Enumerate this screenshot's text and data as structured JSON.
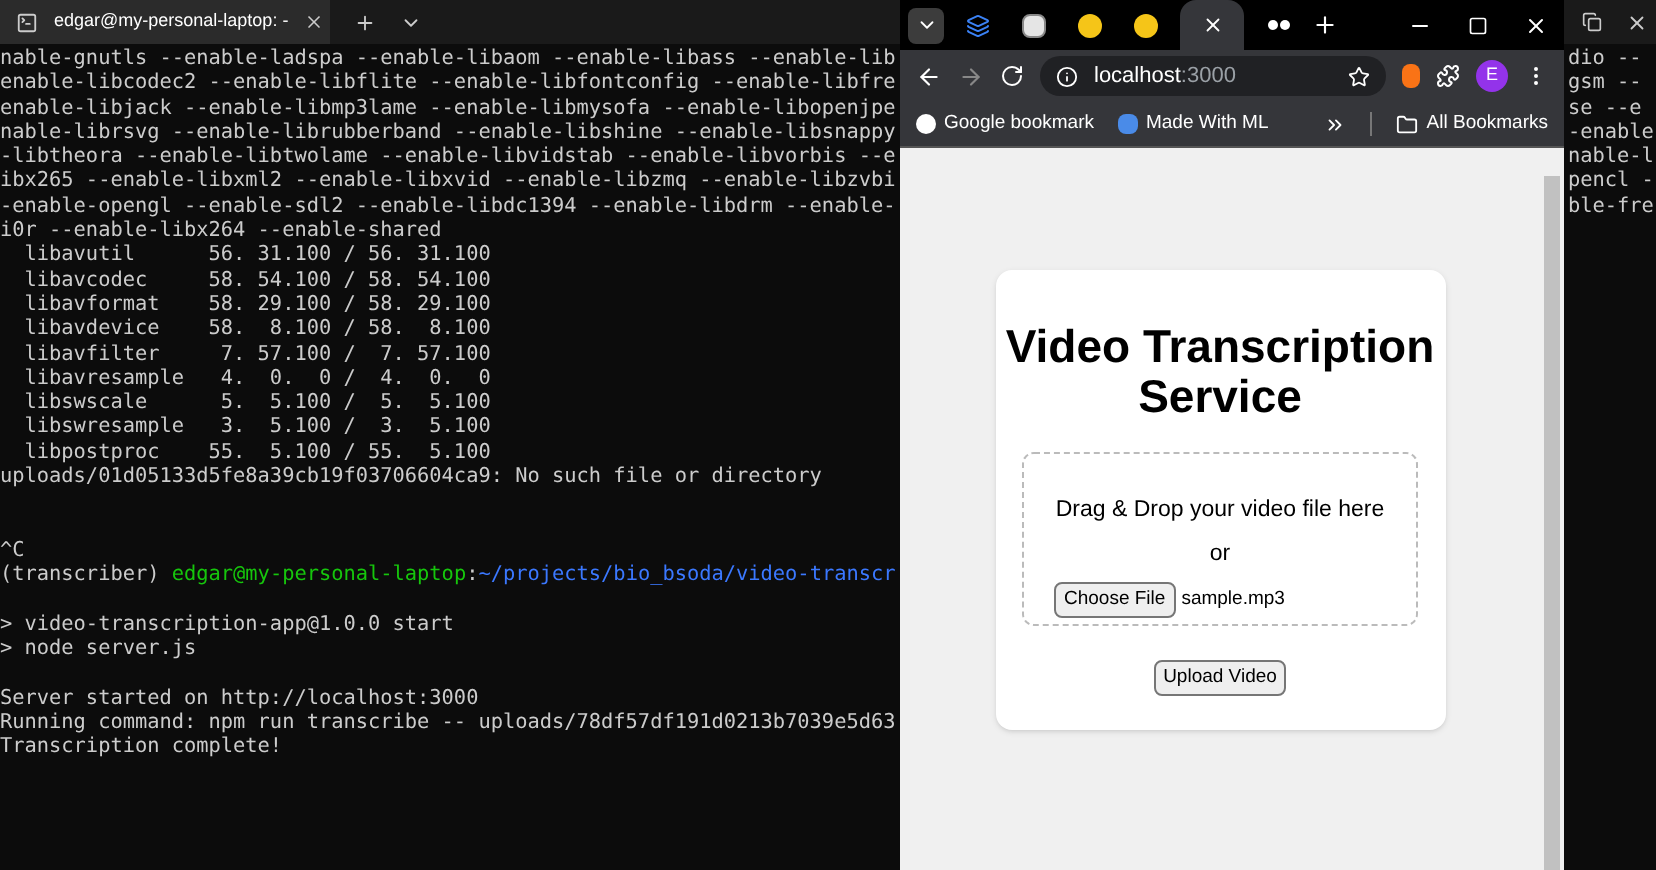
{
  "terminal": {
    "tab_title": "edgar@my-personal-laptop: -",
    "lines": [
      {
        "kind": "text",
        "text": "nable-gnutls --enable-ladspa --enable-libaom --enable-libass --enable-lib"
      },
      {
        "kind": "text",
        "text": "enable-libcodec2 --enable-libflite --enable-libfontconfig --enable-libfre"
      },
      {
        "kind": "text",
        "text": "enable-libjack --enable-libmp3lame --enable-libmysofa --enable-libopenjpe"
      },
      {
        "kind": "text",
        "text": "nable-librsvg --enable-librubberband --enable-libshine --enable-libsnappy"
      },
      {
        "kind": "text",
        "text": "-libtheora --enable-libtwolame --enable-libvidstab --enable-libvorbis --e"
      },
      {
        "kind": "text",
        "text": "ibx265 --enable-libxml2 --enable-libxvid --enable-libzmq --enable-libzvbi"
      },
      {
        "kind": "text",
        "text": "-enable-opengl --enable-sdl2 --enable-libdc1394 --enable-libdrm --enable-"
      },
      {
        "kind": "text",
        "text": "i0r --enable-libx264 --enable-shared"
      },
      {
        "kind": "text",
        "text": "  libavutil      56. 31.100 / 56. 31.100"
      },
      {
        "kind": "text",
        "text": "  libavcodec     58. 54.100 / 58. 54.100"
      },
      {
        "kind": "text",
        "text": "  libavformat    58. 29.100 / 58. 29.100"
      },
      {
        "kind": "text",
        "text": "  libavdevice    58.  8.100 / 58.  8.100"
      },
      {
        "kind": "text",
        "text": "  libavfilter     7. 57.100 /  7. 57.100"
      },
      {
        "kind": "text",
        "text": "  libavresample   4.  0.  0 /  4.  0.  0"
      },
      {
        "kind": "text",
        "text": "  libswscale      5.  5.100 /  5.  5.100"
      },
      {
        "kind": "text",
        "text": "  libswresample   3.  5.100 /  3.  5.100"
      },
      {
        "kind": "text",
        "text": "  libpostproc    55.  5.100 / 55.  5.100"
      },
      {
        "kind": "text",
        "text": "uploads/01d05133d5fe8a39cb19f03706604ca9: No such file or directory"
      },
      {
        "kind": "blank"
      },
      {
        "kind": "blank"
      },
      {
        "kind": "text",
        "text": "^C"
      },
      {
        "kind": "prompt",
        "env": "(transcriber)",
        "user": "edgar@my-personal-laptop",
        "sep": ":",
        "path": "~/projects/bio_bsoda/video-transcr"
      },
      {
        "kind": "blank"
      },
      {
        "kind": "text",
        "text": "> video-transcription-app@1.0.0 start"
      },
      {
        "kind": "text",
        "text": "> node server.js"
      },
      {
        "kind": "blank"
      },
      {
        "kind": "text",
        "text": "Server started on http://localhost:3000"
      },
      {
        "kind": "text",
        "text": "Running command: npm run transcribe -- uploads/78df57df191d0213b7039e5d63"
      },
      {
        "kind": "text",
        "text": "Transcription complete!"
      }
    ],
    "right_edge_lines": [
      "dio --",
      "gsm --",
      "se --e",
      "-enable",
      "nable-l",
      "pencl -",
      "ble-fre"
    ]
  },
  "browser": {
    "tabs": [
      {
        "selected": false
      },
      {
        "selected": false
      },
      {
        "selected": false
      },
      {
        "selected": false
      },
      {
        "selected": true
      },
      {
        "selected": false
      }
    ],
    "address": {
      "host": "localhost",
      "port": ":3000"
    },
    "profile_initial": "E",
    "bookmarks": [
      "Google bookmark",
      "Made With ML"
    ],
    "all_bookmarks": "All Bookmarks",
    "page": {
      "title": "Video Transcription Service",
      "drop_text": "Drag & Drop your video file here",
      "or": "or",
      "choose_button": "Choose File",
      "file_name": "sample.mp3",
      "upload_button": "Upload Video"
    }
  }
}
